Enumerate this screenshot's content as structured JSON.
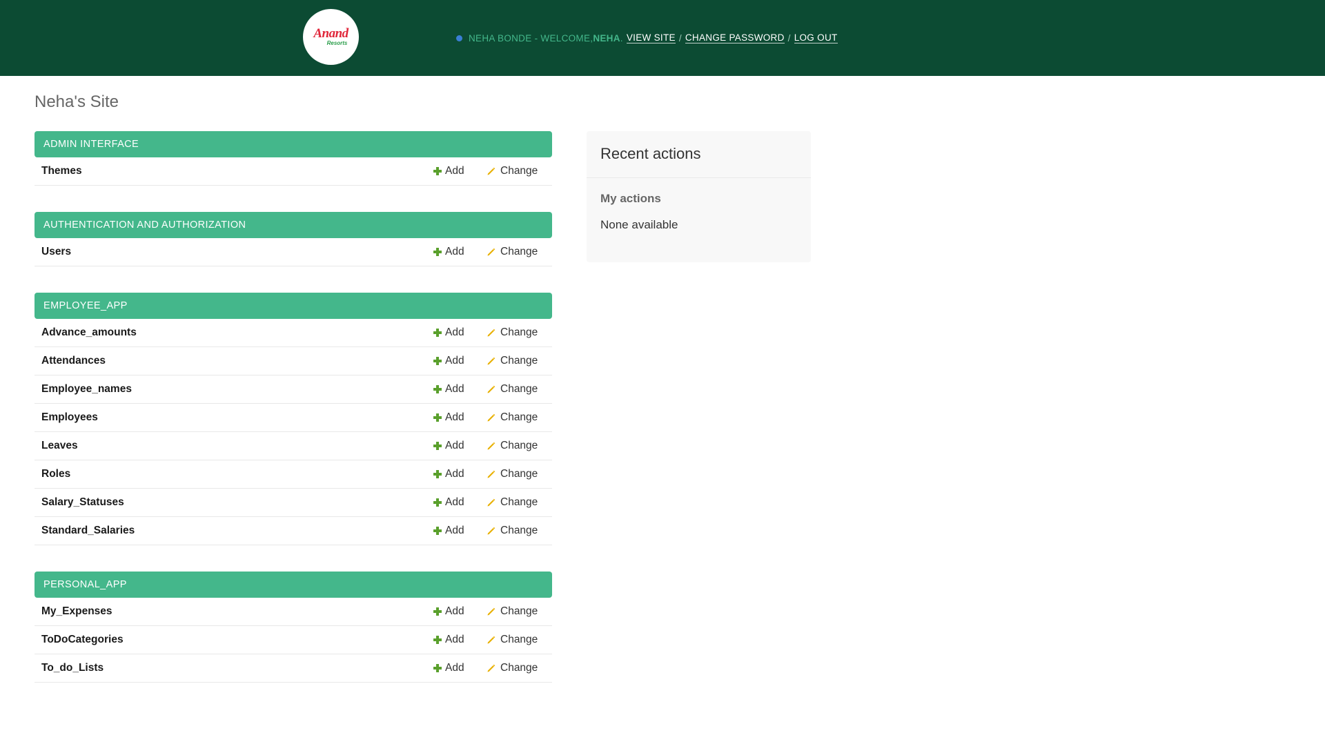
{
  "header": {
    "logo_text": "Anand",
    "logo_subtext": "Resorts",
    "user_prefix": "NEHA BONDE - WELCOME, ",
    "user_name": "NEHA",
    "user_suffix": ".",
    "view_site": "VIEW SITE",
    "change_password": "CHANGE PASSWORD",
    "log_out": "LOG OUT",
    "separator": "/"
  },
  "site_title": "Neha's Site",
  "actions": {
    "add_label": "Add",
    "change_label": "Change"
  },
  "modules": [
    {
      "title": "ADMIN INTERFACE",
      "models": [
        "Themes"
      ]
    },
    {
      "title": "AUTHENTICATION AND AUTHORIZATION",
      "models": [
        "Users"
      ]
    },
    {
      "title": "EMPLOYEE_APP",
      "models": [
        "Advance_amounts",
        "Attendances",
        "Employee_names",
        "Employees",
        "Leaves",
        "Roles",
        "Salary_Statuses",
        "Standard_Salaries"
      ]
    },
    {
      "title": "PERSONAL_APP",
      "models": [
        "My_Expenses",
        "ToDoCategories",
        "To_do_Lists"
      ]
    }
  ],
  "recent_actions": {
    "title": "Recent actions",
    "subtitle": "My actions",
    "empty_text": "None available"
  },
  "colors": {
    "header_bg": "#0c4b33",
    "accent": "#44b78b",
    "add_icon": "#5aa02c",
    "change_icon": "#e8b000"
  },
  "icons": {
    "add": "plus-icon",
    "change": "pencil-icon"
  }
}
